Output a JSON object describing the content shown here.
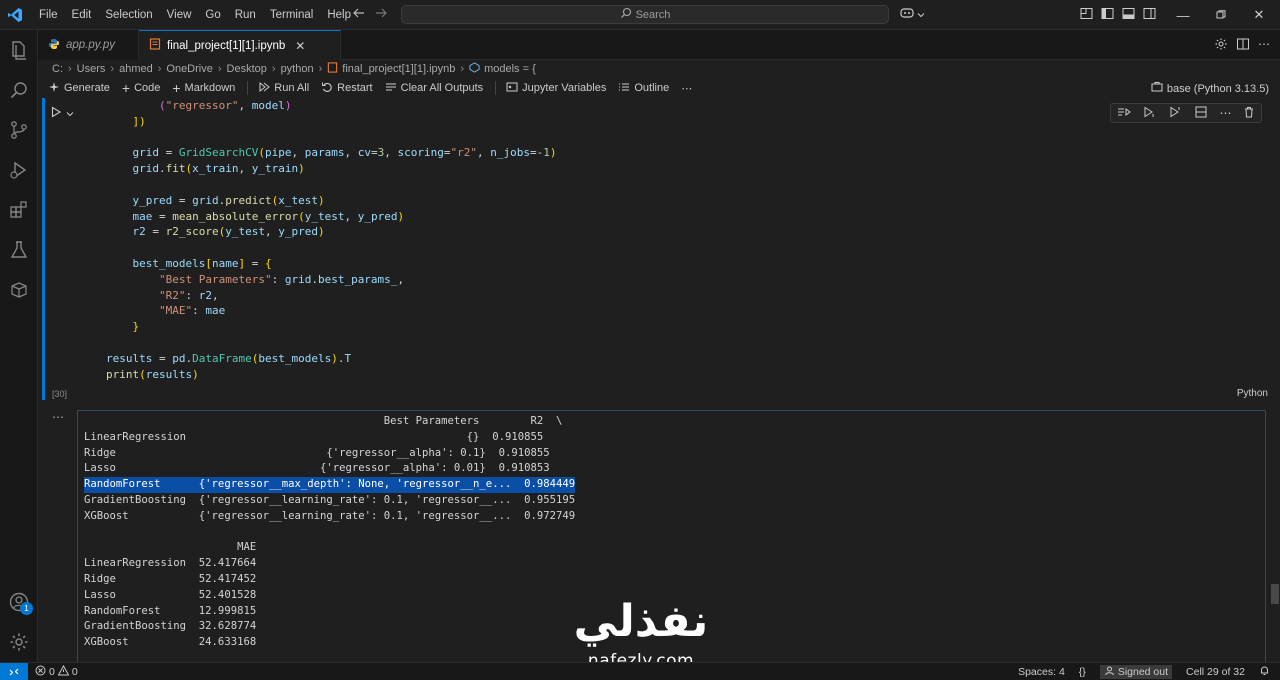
{
  "menu": [
    "File",
    "Edit",
    "Selection",
    "View",
    "Go",
    "Run",
    "Terminal",
    "Help"
  ],
  "search": {
    "placeholder": "Search"
  },
  "tabs": [
    {
      "label": "app.py.py",
      "active": false
    },
    {
      "label": "final_project[1][1].ipynb",
      "active": true
    }
  ],
  "breadcrumb": [
    "C:",
    "Users",
    "ahmed",
    "OneDrive",
    "Desktop",
    "python",
    "final_project[1][1].ipynb",
    "models = {"
  ],
  "toolbar": {
    "generate": "Generate",
    "code": "Code",
    "markdown": "Markdown",
    "run_all": "Run All",
    "restart": "Restart",
    "clear_outputs": "Clear All Outputs",
    "variables": "Jupyter Variables",
    "outline": "Outline",
    "kernel": "base (Python 3.13.5)"
  },
  "cell": {
    "exec_count": "[30]",
    "language": "Python",
    "code_lines": [
      "        (\"regressor\", model)",
      "    ])",
      "",
      "    grid = GridSearchCV(pipe, params, cv=3, scoring=\"r2\", n_jobs=-1)",
      "    grid.fit(x_train, y_train)",
      "",
      "    y_pred = grid.predict(x_test)",
      "    mae = mean_absolute_error(y_test, y_pred)",
      "    r2 = r2_score(y_test, y_pred)",
      "",
      "    best_models[name] = {",
      "        \"Best Parameters\": grid.best_params_,",
      "        \"R2\": r2,",
      "        \"MAE\": mae",
      "    }",
      "",
      "results = pd.DataFrame(best_models).T",
      "print(results)"
    ]
  },
  "output": {
    "lines": [
      "                                               Best Parameters        R2  \\",
      "LinearRegression                                            {}  0.910855",
      "Ridge                                 {'regressor__alpha': 0.1}  0.910855",
      "Lasso                                {'regressor__alpha': 0.01}  0.910853",
      "RandomForest      {'regressor__max_depth': None, 'regressor__n_e...  0.984449",
      "GradientBoosting  {'regressor__learning_rate': 0.1, 'regressor__...  0.955195",
      "XGBoost           {'regressor__learning_rate': 0.1, 'regressor__...  0.972749",
      "",
      "                        MAE",
      "LinearRegression  52.417664",
      "Ridge             52.417452",
      "Lasso             52.401528",
      "RandomForest      12.999815",
      "GradientBoosting  32.628774",
      "XGBoost           24.633168"
    ],
    "highlight_line": 4
  },
  "watermark": {
    "arabic": "نفذلي",
    "latin": "nafezly.com"
  },
  "status": {
    "errors": "0",
    "warnings": "0",
    "spaces": "Spaces: 4",
    "signed_out": "Signed out",
    "cell": "Cell 29 of 32"
  },
  "accounts_badge": "1",
  "colors": {
    "accent": "#0078d4",
    "selection": "#264f78",
    "background": "#1f1f1f"
  }
}
